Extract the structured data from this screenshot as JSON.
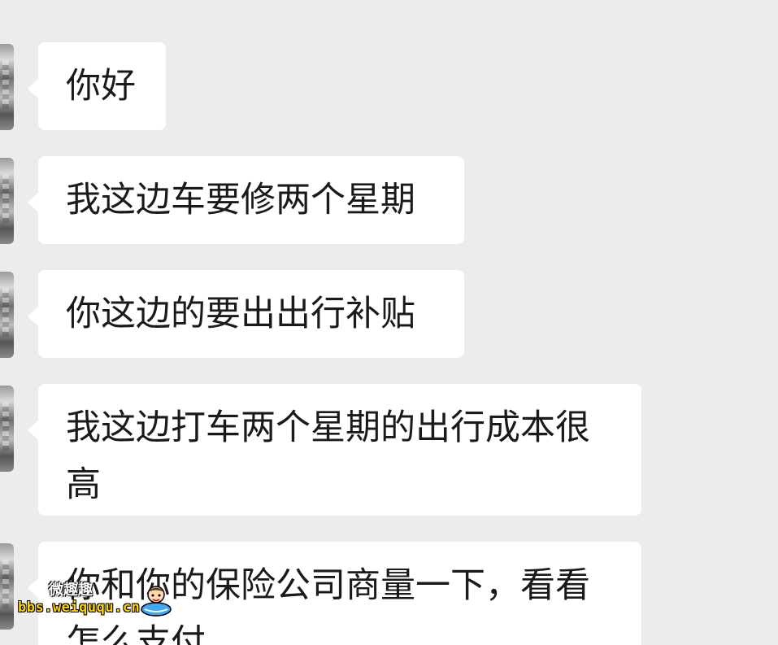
{
  "messages": [
    {
      "text": "你好"
    },
    {
      "text": "我这边车要修两个星期"
    },
    {
      "text": "你这边的要出出行补贴"
    },
    {
      "text": "我这边打车两个星期的出行成本很高"
    },
    {
      "text": "你和你的保险公司商量一下，看看怎么支付"
    }
  ],
  "watermark": {
    "name": "微趣趣",
    "url": "bbs.weiququ.cn"
  }
}
